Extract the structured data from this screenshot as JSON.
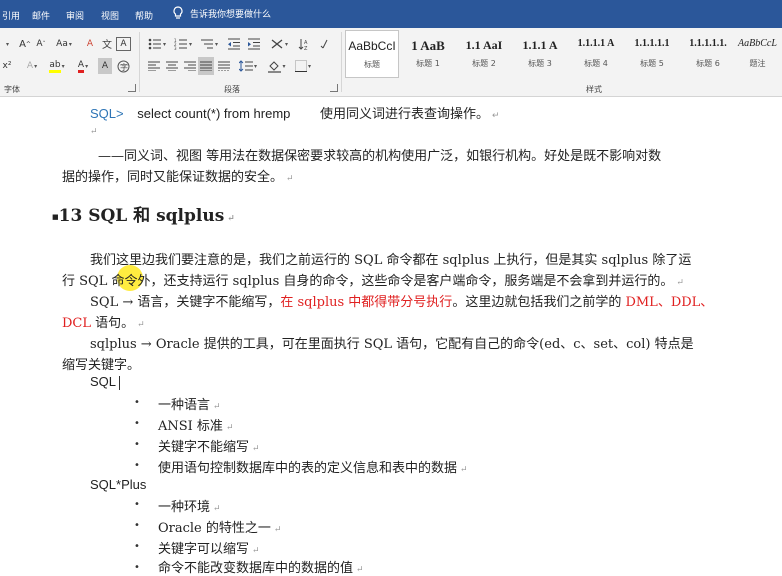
{
  "menu": {
    "items": [
      "引用",
      "邮件",
      "审阅",
      "视图",
      "帮助"
    ],
    "tell_me": "告诉我你想要做什么"
  },
  "ribbon": {
    "font_group_label": "字体",
    "paragraph_group_label": "段落",
    "styles_group_label": "样式",
    "font_buttons": {
      "grow": "A",
      "shrink": "A",
      "case": "Aa",
      "clear": "A",
      "charborder": "A",
      "superscript": "x²",
      "texteffect": "A",
      "highlight": "ab",
      "fontcolor": "A",
      "charshade": "A",
      "enclose": "字"
    },
    "styles": [
      {
        "sample": "AaBbCcI",
        "name": "标题"
      },
      {
        "sample": "1 AaB",
        "name": "标题 1"
      },
      {
        "sample": "1.1 AaI",
        "name": "标题 2"
      },
      {
        "sample": "1.1.1 A",
        "name": "标题 3"
      },
      {
        "sample": "1.1.1.1 A",
        "name": "标题 4"
      },
      {
        "sample": "1.1.1.1.1",
        "name": "标题 5"
      },
      {
        "sample": "1.1.1.1.1.",
        "name": "标题 6"
      },
      {
        "sample": "AaBbCcL",
        "name": "题注"
      }
    ]
  },
  "document": {
    "line1_prompt": "SQL>",
    "line1_code": "select count(*) from hremp",
    "line1_note": "使用同义词进行表查询操作。",
    "para_synonym": "——同义词、视图 等用法在数据保密要求较高的机构使用广泛，如银行机构。好处是既不影响对数",
    "para_synonym2": "据的操作，同时又能保证数据的安全。",
    "heading": "13 SQL 和 sqlplus",
    "para1_l1": "我们这里边我们要注意的是，我们之前运行的 SQL 命令都在 sqlplus 上执行，但是其实 sqlplus 除了运",
    "para1_l2": "行 SQL 命令外，还支持运行 sqlplus 自身的命令，这些命令是客户端命令，服务端是不会拿到并运行的。",
    "para2_a": "SQL → 语言，关键字不能缩写，",
    "para2_red": "在 sqlplus 中都得带分号执行",
    "para2_b": "。这里边就包括我们之前学的 ",
    "para2_red2": "DML、DDL、",
    "para2_red3": "DCL",
    "para2_c": " 语句。",
    "para3_l1": "sqlplus → Oracle 提供的工具，可在里面执行 SQL 语句，它配有自己的命令(ed、c、set、col) 特点是",
    "para3_l2": "缩写关键字。",
    "sql_label": "SQL",
    "sql_items": [
      "一种语言",
      "ANSI 标准",
      "关键字不能缩写",
      "使用语句控制数据库中的表的定义信息和表中的数据"
    ],
    "sqlplus_label": "SQL*Plus",
    "sqlplus_items": [
      "一种环境",
      "Oracle 的特性之一",
      "关键字可以缩写",
      "命令不能改变数据库中的数据的值"
    ]
  },
  "colors": {
    "menubar": "#2b579a",
    "link_blue": "#2e75b6",
    "emphasis_red": "#e02020"
  }
}
